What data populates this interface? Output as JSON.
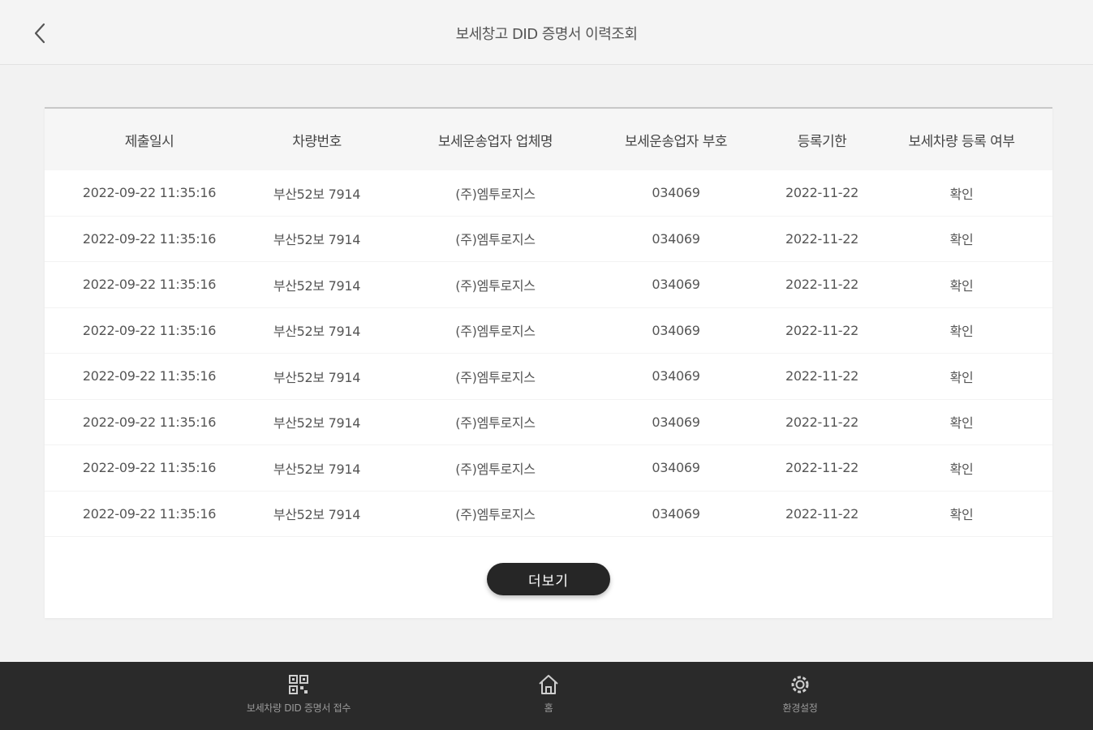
{
  "header": {
    "title": "보세창고 DID 증명서 이력조회"
  },
  "table": {
    "columns": [
      "제출일시",
      "차량번호",
      "보세운송업자 업체명",
      "보세운송업자 부호",
      "등록기한",
      "보세차량 등록 여부"
    ],
    "rows": [
      [
        "2022-09-22  11:35:16",
        "부산52보 7914",
        "(주)엠투로지스",
        "034069",
        "2022-11-22",
        "확인"
      ],
      [
        "2022-09-22  11:35:16",
        "부산52보 7914",
        "(주)엠투로지스",
        "034069",
        "2022-11-22",
        "확인"
      ],
      [
        "2022-09-22  11:35:16",
        "부산52보 7914",
        "(주)엠투로지스",
        "034069",
        "2022-11-22",
        "확인"
      ],
      [
        "2022-09-22  11:35:16",
        "부산52보 7914",
        "(주)엠투로지스",
        "034069",
        "2022-11-22",
        "확인"
      ],
      [
        "2022-09-22  11:35:16",
        "부산52보 7914",
        "(주)엠투로지스",
        "034069",
        "2022-11-22",
        "확인"
      ],
      [
        "2022-09-22  11:35:16",
        "부산52보 7914",
        "(주)엠투로지스",
        "034069",
        "2022-11-22",
        "확인"
      ],
      [
        "2022-09-22  11:35:16",
        "부산52보 7914",
        "(주)엠투로지스",
        "034069",
        "2022-11-22",
        "확인"
      ],
      [
        "2022-09-22  11:35:16",
        "부산52보 7914",
        "(주)엠투로지스",
        "034069",
        "2022-11-22",
        "확인"
      ]
    ],
    "more_label": "더보기"
  },
  "nav": {
    "items": [
      {
        "label": "보세차량 DID 증명서 접수",
        "icon": "qr-icon"
      },
      {
        "label": "홈",
        "icon": "home-icon"
      },
      {
        "label": "환경설정",
        "icon": "settings-icon"
      }
    ]
  },
  "colors": {
    "nav_bg": "#2a2a2a",
    "button_bg": "#262626"
  }
}
